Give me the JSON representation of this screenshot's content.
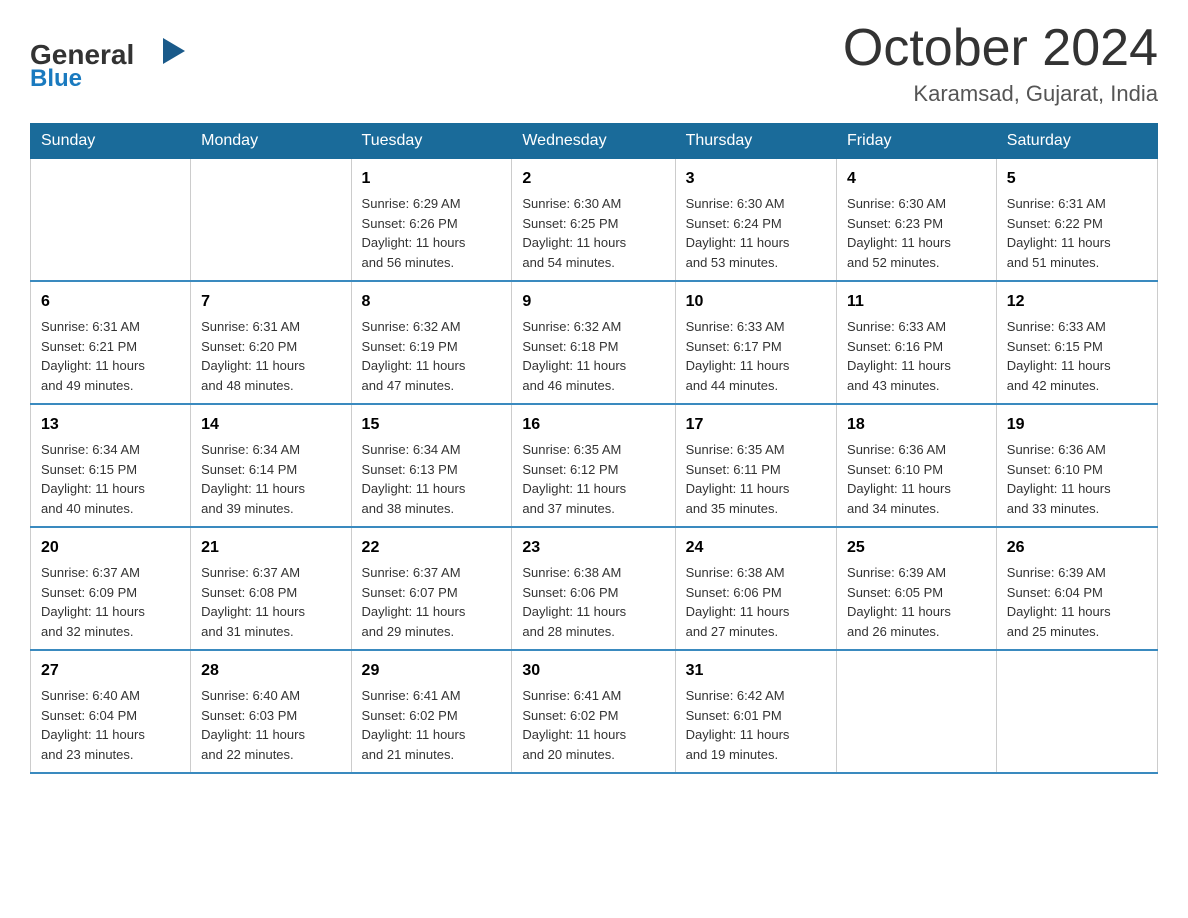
{
  "header": {
    "logo": {
      "general": "General",
      "blue": "Blue"
    },
    "month": "October 2024",
    "location": "Karamsad, Gujarat, India"
  },
  "days_of_week": [
    "Sunday",
    "Monday",
    "Tuesday",
    "Wednesday",
    "Thursday",
    "Friday",
    "Saturday"
  ],
  "weeks": [
    [
      {
        "day": "",
        "info": ""
      },
      {
        "day": "",
        "info": ""
      },
      {
        "day": "1",
        "info": "Sunrise: 6:29 AM\nSunset: 6:26 PM\nDaylight: 11 hours\nand 56 minutes."
      },
      {
        "day": "2",
        "info": "Sunrise: 6:30 AM\nSunset: 6:25 PM\nDaylight: 11 hours\nand 54 minutes."
      },
      {
        "day": "3",
        "info": "Sunrise: 6:30 AM\nSunset: 6:24 PM\nDaylight: 11 hours\nand 53 minutes."
      },
      {
        "day": "4",
        "info": "Sunrise: 6:30 AM\nSunset: 6:23 PM\nDaylight: 11 hours\nand 52 minutes."
      },
      {
        "day": "5",
        "info": "Sunrise: 6:31 AM\nSunset: 6:22 PM\nDaylight: 11 hours\nand 51 minutes."
      }
    ],
    [
      {
        "day": "6",
        "info": "Sunrise: 6:31 AM\nSunset: 6:21 PM\nDaylight: 11 hours\nand 49 minutes."
      },
      {
        "day": "7",
        "info": "Sunrise: 6:31 AM\nSunset: 6:20 PM\nDaylight: 11 hours\nand 48 minutes."
      },
      {
        "day": "8",
        "info": "Sunrise: 6:32 AM\nSunset: 6:19 PM\nDaylight: 11 hours\nand 47 minutes."
      },
      {
        "day": "9",
        "info": "Sunrise: 6:32 AM\nSunset: 6:18 PM\nDaylight: 11 hours\nand 46 minutes."
      },
      {
        "day": "10",
        "info": "Sunrise: 6:33 AM\nSunset: 6:17 PM\nDaylight: 11 hours\nand 44 minutes."
      },
      {
        "day": "11",
        "info": "Sunrise: 6:33 AM\nSunset: 6:16 PM\nDaylight: 11 hours\nand 43 minutes."
      },
      {
        "day": "12",
        "info": "Sunrise: 6:33 AM\nSunset: 6:15 PM\nDaylight: 11 hours\nand 42 minutes."
      }
    ],
    [
      {
        "day": "13",
        "info": "Sunrise: 6:34 AM\nSunset: 6:15 PM\nDaylight: 11 hours\nand 40 minutes."
      },
      {
        "day": "14",
        "info": "Sunrise: 6:34 AM\nSunset: 6:14 PM\nDaylight: 11 hours\nand 39 minutes."
      },
      {
        "day": "15",
        "info": "Sunrise: 6:34 AM\nSunset: 6:13 PM\nDaylight: 11 hours\nand 38 minutes."
      },
      {
        "day": "16",
        "info": "Sunrise: 6:35 AM\nSunset: 6:12 PM\nDaylight: 11 hours\nand 37 minutes."
      },
      {
        "day": "17",
        "info": "Sunrise: 6:35 AM\nSunset: 6:11 PM\nDaylight: 11 hours\nand 35 minutes."
      },
      {
        "day": "18",
        "info": "Sunrise: 6:36 AM\nSunset: 6:10 PM\nDaylight: 11 hours\nand 34 minutes."
      },
      {
        "day": "19",
        "info": "Sunrise: 6:36 AM\nSunset: 6:10 PM\nDaylight: 11 hours\nand 33 minutes."
      }
    ],
    [
      {
        "day": "20",
        "info": "Sunrise: 6:37 AM\nSunset: 6:09 PM\nDaylight: 11 hours\nand 32 minutes."
      },
      {
        "day": "21",
        "info": "Sunrise: 6:37 AM\nSunset: 6:08 PM\nDaylight: 11 hours\nand 31 minutes."
      },
      {
        "day": "22",
        "info": "Sunrise: 6:37 AM\nSunset: 6:07 PM\nDaylight: 11 hours\nand 29 minutes."
      },
      {
        "day": "23",
        "info": "Sunrise: 6:38 AM\nSunset: 6:06 PM\nDaylight: 11 hours\nand 28 minutes."
      },
      {
        "day": "24",
        "info": "Sunrise: 6:38 AM\nSunset: 6:06 PM\nDaylight: 11 hours\nand 27 minutes."
      },
      {
        "day": "25",
        "info": "Sunrise: 6:39 AM\nSunset: 6:05 PM\nDaylight: 11 hours\nand 26 minutes."
      },
      {
        "day": "26",
        "info": "Sunrise: 6:39 AM\nSunset: 6:04 PM\nDaylight: 11 hours\nand 25 minutes."
      }
    ],
    [
      {
        "day": "27",
        "info": "Sunrise: 6:40 AM\nSunset: 6:04 PM\nDaylight: 11 hours\nand 23 minutes."
      },
      {
        "day": "28",
        "info": "Sunrise: 6:40 AM\nSunset: 6:03 PM\nDaylight: 11 hours\nand 22 minutes."
      },
      {
        "day": "29",
        "info": "Sunrise: 6:41 AM\nSunset: 6:02 PM\nDaylight: 11 hours\nand 21 minutes."
      },
      {
        "day": "30",
        "info": "Sunrise: 6:41 AM\nSunset: 6:02 PM\nDaylight: 11 hours\nand 20 minutes."
      },
      {
        "day": "31",
        "info": "Sunrise: 6:42 AM\nSunset: 6:01 PM\nDaylight: 11 hours\nand 19 minutes."
      },
      {
        "day": "",
        "info": ""
      },
      {
        "day": "",
        "info": ""
      }
    ]
  ]
}
